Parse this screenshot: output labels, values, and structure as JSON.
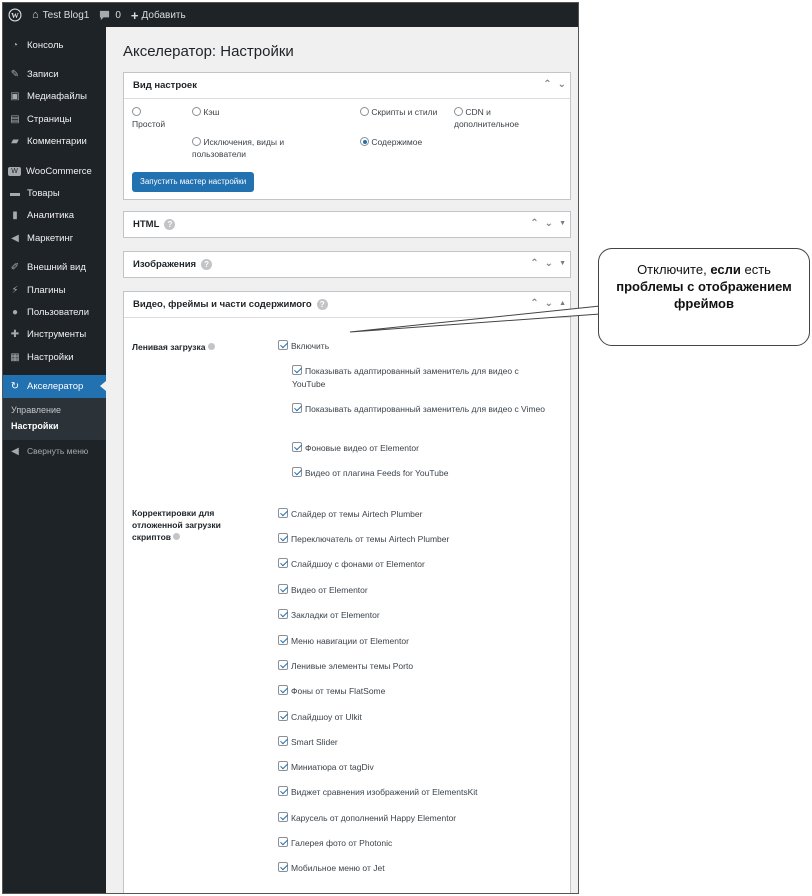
{
  "adminbar": {
    "site_name": "Test Blog1",
    "comments_count": "0",
    "add_label": "Добавить"
  },
  "sidebar": {
    "items": [
      {
        "label": "Консоль",
        "icon": "dashboard-icon"
      },
      {
        "label": "Записи",
        "icon": "pin-icon"
      },
      {
        "label": "Медиафайлы",
        "icon": "media-icon"
      },
      {
        "label": "Страницы",
        "icon": "page-icon"
      },
      {
        "label": "Комментарии",
        "icon": "comment-icon"
      },
      {
        "label": "WooCommerce",
        "icon": "woo-icon"
      },
      {
        "label": "Товары",
        "icon": "archive-icon"
      },
      {
        "label": "Аналитика",
        "icon": "chart-icon"
      },
      {
        "label": "Маркетинг",
        "icon": "megaphone-icon"
      },
      {
        "label": "Внешний вид",
        "icon": "brush-icon"
      },
      {
        "label": "Плагины",
        "icon": "plugin-icon"
      },
      {
        "label": "Пользователи",
        "icon": "user-icon"
      },
      {
        "label": "Инструменты",
        "icon": "wrench-icon"
      },
      {
        "label": "Настройки",
        "icon": "settings-icon"
      },
      {
        "label": "Акселератор",
        "icon": "accelerator-icon"
      }
    ],
    "submenu": [
      "Управление",
      "Настройки"
    ],
    "collapse_label": "Свернуть меню"
  },
  "page": {
    "title": "Акселератор: Настройки"
  },
  "settings_view": {
    "title": "Вид настроек",
    "options": [
      {
        "label": "Простой",
        "checked": false
      },
      {
        "label": "Кэш",
        "checked": false
      },
      {
        "label": "Скрипты и стили",
        "checked": false
      },
      {
        "label": "CDN и дополнительное",
        "checked": false
      },
      {
        "label": "Исключения, виды и пользователи",
        "checked": false
      },
      {
        "label": "Содержимое",
        "checked": true
      }
    ],
    "wizard_button": "Запустить мастер настройки"
  },
  "panels": {
    "html": "HTML",
    "images": "Изображения",
    "video": "Видео, фреймы и части содержимого"
  },
  "lazy": {
    "label": "Ленивая загрузка",
    "enable": "Включить",
    "sub": [
      "Показывать адаптированный заменитель для видео с YouTube",
      "Показывать адаптированный заменитель для видео с Vimeo",
      "Фоновые видео от Elementor",
      "Видео от плагина Feeds for YouTube"
    ]
  },
  "fixes": {
    "label": "Корректировки для отложенной загрузки скриптов",
    "items": [
      "Слайдер от темы Airtech Plumber",
      "Переключатель от темы Airtech Plumber",
      "Слайдшоу с фонами от Elementor",
      "Видео от Elementor",
      "Закладки от Elementor",
      "Меню навигации от Elementor",
      "Ленивые элементы темы Porto",
      "Фоны от темы FlatSome",
      "Слайдшоу от Ulkit",
      "Smart Slider",
      "Миниатюра от tagDiv",
      "Виджет сравнения изображений от ElementsKit",
      "Карусель от дополнений Happy Elementor",
      "Галерея фото от Photonic",
      "Мобильное меню от Jet"
    ]
  },
  "callout": {
    "part1": "Отключите, ",
    "bold1": "если",
    "part2": " есть ",
    "bold2": "проблемы с отображением фреймов"
  }
}
